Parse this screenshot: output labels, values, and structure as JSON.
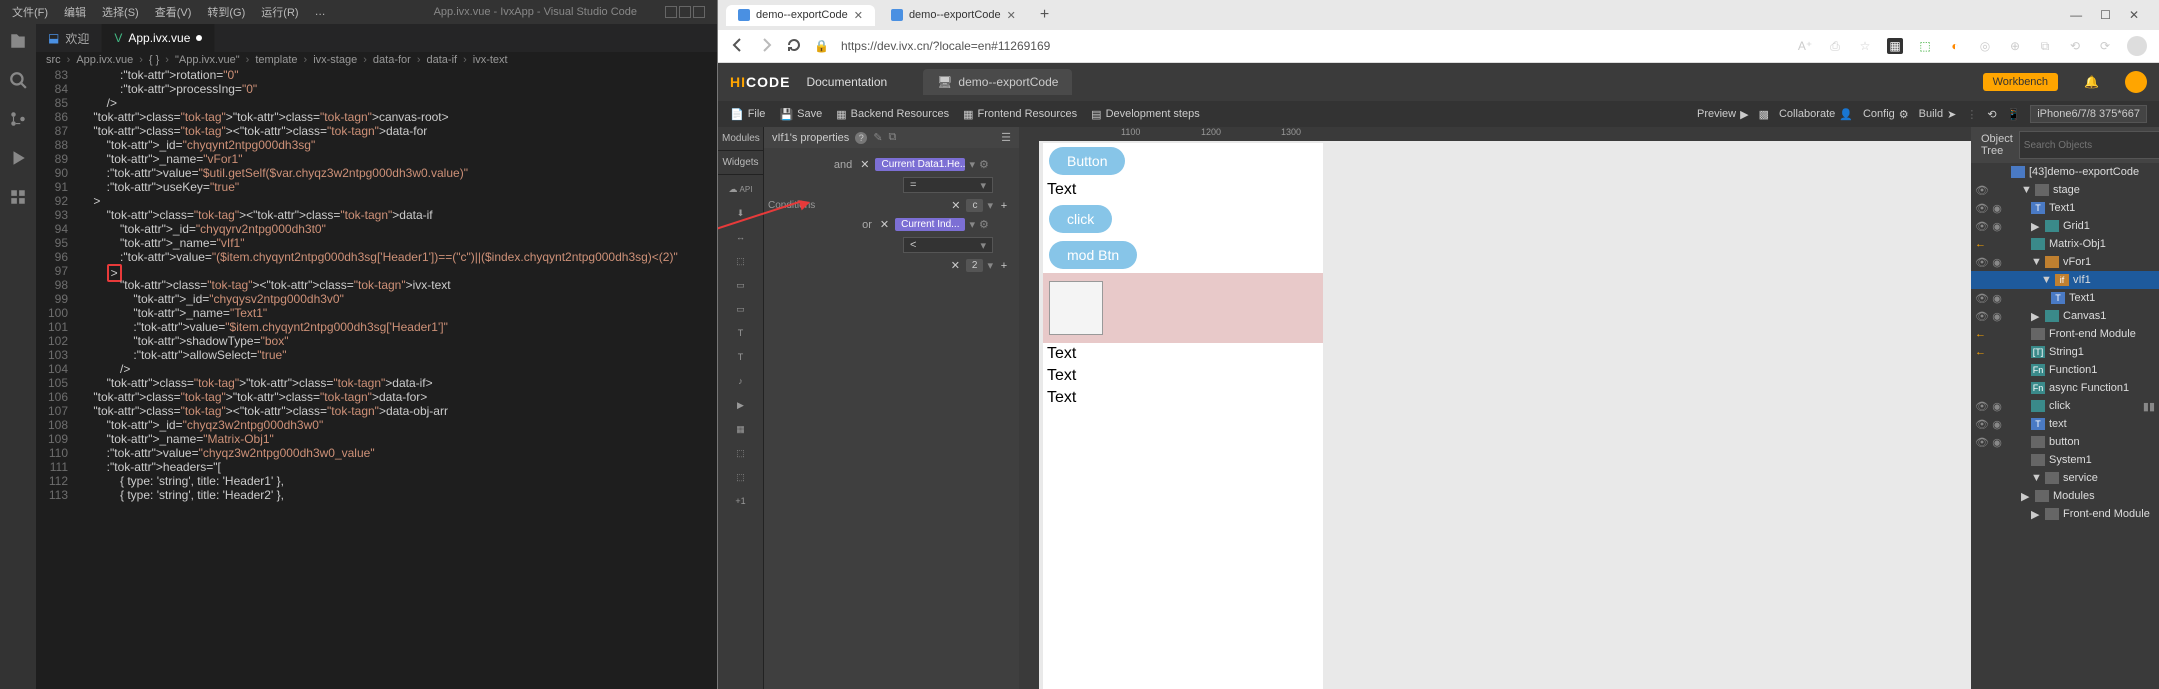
{
  "vscode": {
    "menu": [
      "文件(F)",
      "编辑",
      "选择(S)",
      "查看(V)",
      "转到(G)",
      "运行(R)",
      "…"
    ],
    "title": "App.ivx.vue - IvxApp - Visual Studio Code",
    "tabs": [
      {
        "label": "欢迎",
        "active": false
      },
      {
        "label": "App.ivx.vue",
        "active": true,
        "modified": true
      }
    ],
    "breadcrumb": [
      "src",
      "App.ivx.vue",
      "{ }",
      "\"App.ivx.vue\"",
      "template",
      "ivx-stage",
      "data-for",
      "data-if",
      "ivx-text"
    ],
    "lines_start": 83,
    "code": [
      ":rotation=\"0\"",
      ":processIng=\"0\"",
      "/>",
      "</canvas-root>",
      "<data-for",
      "_id=\"chyqynt2ntpg000dh3sg\"",
      "_name=\"vFor1\"",
      ":value=\"$util.getSelf($var.chyqz3w2ntpg000dh3w0.value)\"",
      ":useKey=\"true\"",
      ">",
      "<data-if",
      "_id=\"chyqyrv2ntpg000dh3t0\"",
      "_name=\"vIf1\"",
      ":value=\"($item.chyqynt2ntpg000dh3sg['Header1'])==(&quot;c&quot;)||($index.chyqynt2ntpg000dh3sg)&lt;(2)\"",
      ">",
      "<ivx-text",
      "_id=\"chyqysv2ntpg000dh3v0\"",
      "_name=\"Text1\"",
      ":value=\"$item.chyqynt2ntpg000dh3sg['Header1']\"",
      "shadowType=\"box\"",
      ":allowSelect=\"true\"",
      "/>",
      "</data-if>",
      "</data-for>",
      "<data-obj-arr",
      "_id=\"chyqz3w2ntpg000dh3w0\"",
      "_name=\"Matrix-Obj1\"",
      ":value=\"chyqz3w2ntpg000dh3w0_value\"",
      ":headers=\"[",
      "{ type: 'string', title: 'Header1' },",
      "{ type: 'string', title: 'Header2' },"
    ],
    "highlight_line": 97
  },
  "browser": {
    "tabs": [
      {
        "label": "demo--exportCode",
        "active": true
      },
      {
        "label": "demo--exportCode",
        "active": false
      }
    ],
    "url": "https://dev.ivx.cn/?locale=en#11269169",
    "winbtns": [
      "—",
      "☐",
      "✕"
    ]
  },
  "app": {
    "logo_hi": "HI",
    "logo_code": "CODE",
    "doc": "Documentation",
    "project_tab": "demo--exportCode",
    "workbench": "Workbench",
    "toolbar": {
      "file": "File",
      "save": "Save",
      "backend": "Backend Resources",
      "frontend": "Frontend Resources",
      "devsteps": "Development steps",
      "preview": "Preview",
      "collab": "Collaborate",
      "config": "Config",
      "build": "Build",
      "device": "iPhone6/7/8 375*667"
    },
    "leftcol": {
      "modules": "Modules",
      "widgets": "Widgets",
      "api": "API"
    },
    "props": {
      "title": "vIf1's properties",
      "side_label": "Conditions",
      "rows": [
        {
          "op": "and",
          "tag": "Current Data1.He...",
          "sel": ""
        },
        {
          "op": "",
          "sel": "="
        },
        {
          "op": "",
          "tag_x": "c",
          "sel": ""
        },
        {
          "op": "or",
          "tag": "Current Ind...",
          "sel": ""
        },
        {
          "op": "",
          "sel": "<"
        },
        {
          "op": "",
          "tag_x": "2",
          "sel": ""
        }
      ]
    },
    "canvas": {
      "btn1": "Button",
      "txt1": "Text",
      "btn2": "click",
      "btn3": "mod Btn",
      "txt2": "Text",
      "txt3": "Text",
      "txt4": "Text",
      "ruler": [
        "",
        "1100",
        "1200",
        "1300"
      ]
    },
    "tree": {
      "head_left": "Object Tree",
      "search_ph": "Search Objects",
      "items": [
        {
          "ind": 0,
          "icn": "blue",
          "name": "[43]demo--exportCode"
        },
        {
          "ind": 1,
          "icn": "gray",
          "name": "stage",
          "tog": "▼",
          "eye": true
        },
        {
          "ind": 2,
          "icn": "blue",
          "name": "Text1",
          "eye": true,
          "chk": true,
          "txt": "T"
        },
        {
          "ind": 2,
          "icn": "teal",
          "name": "Grid1",
          "eye": true,
          "chk": true,
          "arr": "▶"
        },
        {
          "ind": 2,
          "icn": "teal",
          "name": "Matrix-Obj1",
          "arrow": true
        },
        {
          "ind": 2,
          "icn": "orange",
          "name": "vFor1",
          "tog": "▼",
          "eye": true,
          "chk": true
        },
        {
          "ind": 3,
          "icn": "orange",
          "name": "vIf1",
          "tog": "▼",
          "sel": true,
          "txt": "if"
        },
        {
          "ind": 4,
          "icn": "blue",
          "name": "Text1",
          "eye": true,
          "chk": true,
          "txt": "T"
        },
        {
          "ind": 2,
          "icn": "teal",
          "name": "Canvas1",
          "eye": true,
          "chk": true,
          "arr": "▶"
        },
        {
          "ind": 2,
          "icn": "gray",
          "name": "Front-end Module",
          "arrow": true
        },
        {
          "ind": 2,
          "icn": "teal",
          "name": "String1",
          "arrow": true,
          "txt": "[T]"
        },
        {
          "ind": 2,
          "icn": "teal",
          "name": "Function1",
          "txt": "Fn"
        },
        {
          "ind": 2,
          "icn": "teal",
          "name": "async Function1",
          "txt": "Fn"
        },
        {
          "ind": 2,
          "icn": "teal",
          "name": "click",
          "eye": true,
          "chk": true,
          "right": "▮▮"
        },
        {
          "ind": 2,
          "icn": "blue",
          "name": "text",
          "eye": true,
          "chk": true,
          "txt": "T"
        },
        {
          "ind": 2,
          "icn": "gray",
          "name": "button",
          "eye": true,
          "chk": true
        },
        {
          "ind": 2,
          "icn": "gray",
          "name": "System1"
        },
        {
          "ind": 2,
          "icn": "gray",
          "name": "service",
          "tog": "▼"
        },
        {
          "ind": 1,
          "icn": "gray",
          "name": "Modules",
          "tog": "▼",
          "arr": "▶"
        },
        {
          "ind": 2,
          "icn": "gray",
          "name": "Front-end Module",
          "arr": "▶"
        }
      ]
    }
  }
}
